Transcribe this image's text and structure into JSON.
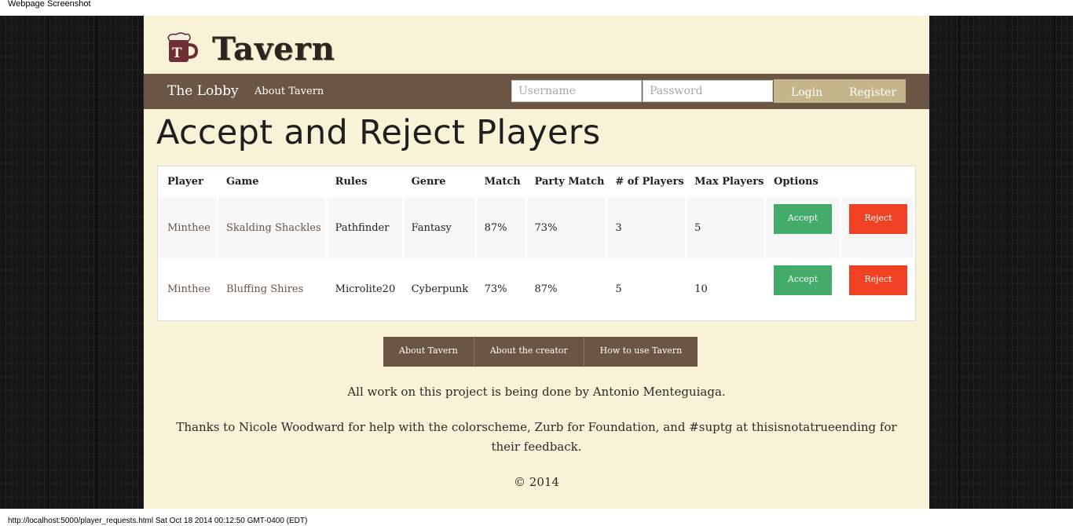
{
  "window": {
    "title": "Webpage Screenshot"
  },
  "status_bar": {
    "text": "http://localhost:5000/player_requests.html Sat Oct 18 2014 00:12:50 GMT-0400 (EDT)"
  },
  "brand": {
    "name": "Tavern",
    "logo_icon": "beer-mug-icon"
  },
  "nav": {
    "lobby": "The Lobby",
    "about": "About Tavern",
    "username_placeholder": "Username",
    "password_placeholder": "Password",
    "login": "Login",
    "register": "Register"
  },
  "page": {
    "title": "Accept and Reject Players"
  },
  "table": {
    "headers": [
      "Player",
      "Game",
      "Rules",
      "Genre",
      "Match",
      "Party Match",
      "# of Players",
      "Max Players",
      "Options"
    ],
    "rows": [
      {
        "player": "Minthee",
        "game": "Skalding Shackles",
        "rules": "Pathfinder",
        "genre": "Fantasy",
        "match": "87%",
        "party_match": "73%",
        "num_players": "3",
        "max_players": "5",
        "accept": "Accept",
        "reject": "Reject"
      },
      {
        "player": "Minthee",
        "game": "Bluffing Shires",
        "rules": "Microlite20",
        "genre": "Cyberpunk",
        "match": "73%",
        "party_match": "87%",
        "num_players": "5",
        "max_players": "10",
        "accept": "Accept",
        "reject": "Reject"
      }
    ]
  },
  "footer": {
    "links": [
      "About Tavern",
      "About the creator",
      "How to use Tavern"
    ],
    "credit": "All work on this project is being done by Antonio Menteguiaga.",
    "thanks": "Thanks to Nicole Woodward for help with the colorscheme, Zurb for Foundation, and #suptg at thisisnotatrueending for their feedback.",
    "copyright": "© 2014"
  },
  "colors": {
    "page_bg": "#f8f3d7",
    "nav_bg": "#6b5646",
    "button_tan": "#c4b58b",
    "accept_green": "#43ac6a",
    "reject_red": "#f04124",
    "link_brown": "#6b5646"
  }
}
